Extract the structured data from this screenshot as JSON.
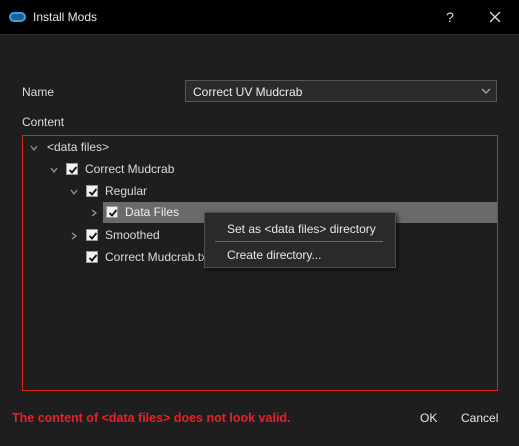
{
  "window": {
    "title": "Install Mods",
    "help": "?"
  },
  "form": {
    "name_label": "Name",
    "name_value": "Correct UV Mudcrab",
    "content_label": "Content"
  },
  "tree": {
    "items": [
      {
        "label": "<data files>",
        "checkbox": false,
        "expanded": true
      },
      {
        "label": "Correct Mudcrab",
        "checkbox": true,
        "checked": true,
        "expanded": true
      },
      {
        "label": "Regular",
        "checkbox": true,
        "checked": true,
        "expanded": true
      },
      {
        "label": "Data Files",
        "checkbox": true,
        "checked": true,
        "expanded": false,
        "selected": true
      },
      {
        "label": "Smoothed",
        "checkbox": true,
        "checked": true,
        "expanded": false
      },
      {
        "label": "Correct Mudcrab.txt",
        "checkbox": true,
        "checked": true
      }
    ]
  },
  "context_menu": {
    "items": [
      "Set as <data files> directory",
      "Create directory..."
    ]
  },
  "status": {
    "error": "The content of <data files> does not look valid."
  },
  "buttons": {
    "ok": "OK",
    "cancel": "Cancel"
  },
  "colors": {
    "error": "#e8202a",
    "border_invalid": "#d22222",
    "selection": "#6a6a6a",
    "accent": "#3aa0e8"
  }
}
